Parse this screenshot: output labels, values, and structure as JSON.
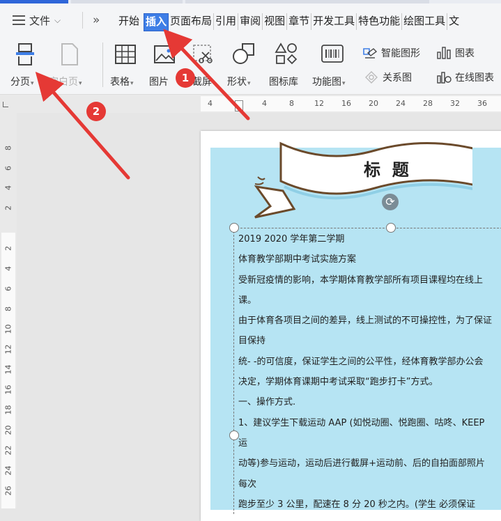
{
  "menubar": {
    "file_label": "文件",
    "tabs": [
      "开始",
      "插入",
      "页面布局",
      "引用",
      "审阅",
      "视图",
      "章节",
      "开发工具",
      "特色功能",
      "绘图工具",
      "文"
    ],
    "active_tab": "插入"
  },
  "ribbon": {
    "page_break": "分页",
    "blank_page": "空白页",
    "table": "表格",
    "picture": "图片",
    "screenshot": "截屏",
    "shape": "形状",
    "icon_lib": "图标库",
    "func_chart": "功能图",
    "smart_shape": "智能图形",
    "chart": "图表",
    "relation": "关系图",
    "online_chart": "在线图表"
  },
  "ruler_top": [
    "4",
    "4",
    "8",
    "12",
    "16",
    "20",
    "24",
    "28",
    "32",
    "36"
  ],
  "ruler_left": [
    "8",
    "6",
    "4",
    "2",
    "2",
    "4",
    "6",
    "8",
    "10",
    "12",
    "14",
    "16",
    "18",
    "20",
    "22",
    "24",
    "26"
  ],
  "document": {
    "title": "标  题",
    "lines": [
      "2019  2020 学年第二学期",
      "体育教学部期中考试实施方案",
      "受新冠疫情的影响，本学期体育教学部所有项目课程均在线上",
      "课。",
      "由于体育各项目之间的差异，线上测试的不可操控性，为了保证",
      "目保持",
      "统- -的可信度，保证学生之间的公平性，经体育教学部办公会",
      "决定，学期体育课期中考试采取“跑步打卡”方式。",
      "一、操作方式.",
      "1、建议学生下载运动 AAP (如悦动圈、悦跑圈、咕咚、KEEP",
      "运",
      "动等)参与运动，运动后进行截屏+运动前、后的自拍面部照片",
      "每次",
      "跑步至少 3 公里，配速在 8 分 20 秒之内。(学生  必须保证"
    ]
  },
  "annotations": [
    "1",
    "2"
  ],
  "colors": {
    "active_tab": "#3e7ee6",
    "badge": "#e53935",
    "doc_bg": "#b6e4f3"
  }
}
